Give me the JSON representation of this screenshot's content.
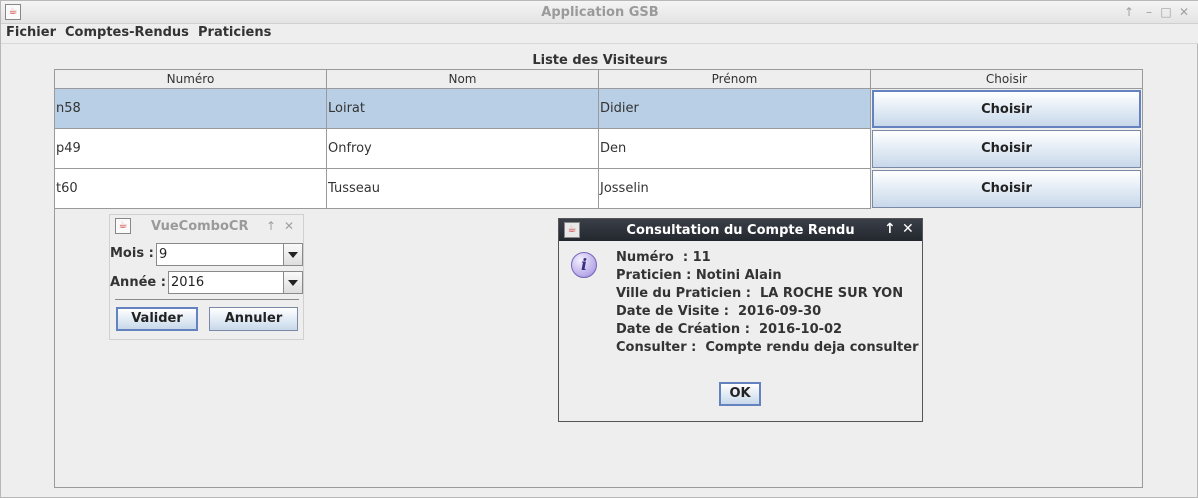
{
  "window": {
    "title": "Application GSB",
    "controls": [
      "↑",
      "–",
      "□",
      "✕"
    ]
  },
  "menu": {
    "items": [
      "Fichier",
      "Comptes-Rendus",
      "Praticiens"
    ]
  },
  "list": {
    "title": "Liste des Visiteurs",
    "columns": [
      "Numéro",
      "Nom",
      "Prénom",
      "Choisir"
    ],
    "rows": [
      {
        "numero": "n58",
        "nom": "Loirat",
        "prenom": "Didier",
        "action": "Choisir",
        "selected": true
      },
      {
        "numero": "p49",
        "nom": "Onfroy",
        "prenom": "Den",
        "action": "Choisir",
        "selected": false
      },
      {
        "numero": "t60",
        "nom": "Tusseau",
        "prenom": "Josselin",
        "action": "Choisir",
        "selected": false
      }
    ]
  },
  "combo_window": {
    "title": "VueComboCR",
    "mois_label": "Mois :",
    "mois_value": "9",
    "annee_label": "Année :",
    "annee_value": "2016",
    "valider_label": "Valider",
    "annuler_label": "Annuler"
  },
  "dialog": {
    "title": "Consultation du Compte Rendu",
    "lines": [
      "Numéro  : 11",
      "Praticien : Notini Alain",
      "Ville du Praticien :  LA ROCHE SUR YON",
      "Date de Visite :  2016-09-30",
      "Date de Création :  2016-10-02",
      "Consulter :  Compte rendu deja consulter"
    ],
    "ok_label": "OK"
  },
  "icons": {
    "app": "java-icon",
    "dialog_message": "info-icon"
  },
  "colors": {
    "selected_row": "#b8cfe5",
    "dialog_title_bg": "#23272e",
    "focus_border": "#6382bf"
  }
}
